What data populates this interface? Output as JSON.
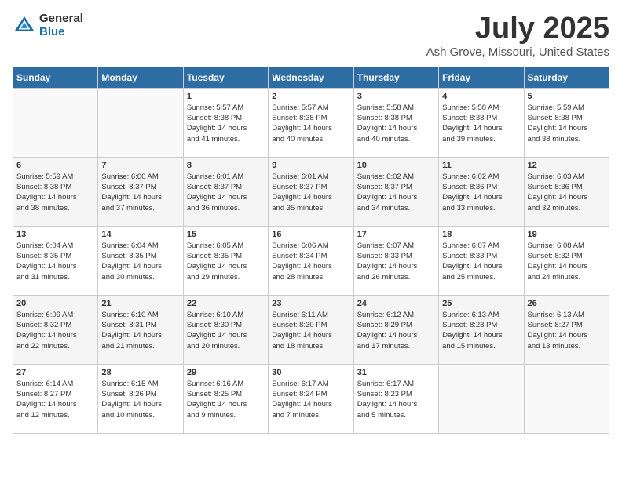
{
  "logo": {
    "general": "General",
    "blue": "Blue"
  },
  "title": "July 2025",
  "subtitle": "Ash Grove, Missouri, United States",
  "headers": [
    "Sunday",
    "Monday",
    "Tuesday",
    "Wednesday",
    "Thursday",
    "Friday",
    "Saturday"
  ],
  "weeks": [
    [
      {
        "day": "",
        "info": ""
      },
      {
        "day": "",
        "info": ""
      },
      {
        "day": "1",
        "info": "Sunrise: 5:57 AM\nSunset: 8:38 PM\nDaylight: 14 hours\nand 41 minutes."
      },
      {
        "day": "2",
        "info": "Sunrise: 5:57 AM\nSunset: 8:38 PM\nDaylight: 14 hours\nand 40 minutes."
      },
      {
        "day": "3",
        "info": "Sunrise: 5:58 AM\nSunset: 8:38 PM\nDaylight: 14 hours\nand 40 minutes."
      },
      {
        "day": "4",
        "info": "Sunrise: 5:58 AM\nSunset: 8:38 PM\nDaylight: 14 hours\nand 39 minutes."
      },
      {
        "day": "5",
        "info": "Sunrise: 5:59 AM\nSunset: 8:38 PM\nDaylight: 14 hours\nand 38 minutes."
      }
    ],
    [
      {
        "day": "6",
        "info": "Sunrise: 5:59 AM\nSunset: 8:38 PM\nDaylight: 14 hours\nand 38 minutes."
      },
      {
        "day": "7",
        "info": "Sunrise: 6:00 AM\nSunset: 8:37 PM\nDaylight: 14 hours\nand 37 minutes."
      },
      {
        "day": "8",
        "info": "Sunrise: 6:01 AM\nSunset: 8:37 PM\nDaylight: 14 hours\nand 36 minutes."
      },
      {
        "day": "9",
        "info": "Sunrise: 6:01 AM\nSunset: 8:37 PM\nDaylight: 14 hours\nand 35 minutes."
      },
      {
        "day": "10",
        "info": "Sunrise: 6:02 AM\nSunset: 8:37 PM\nDaylight: 14 hours\nand 34 minutes."
      },
      {
        "day": "11",
        "info": "Sunrise: 6:02 AM\nSunset: 8:36 PM\nDaylight: 14 hours\nand 33 minutes."
      },
      {
        "day": "12",
        "info": "Sunrise: 6:03 AM\nSunset: 8:36 PM\nDaylight: 14 hours\nand 32 minutes."
      }
    ],
    [
      {
        "day": "13",
        "info": "Sunrise: 6:04 AM\nSunset: 8:35 PM\nDaylight: 14 hours\nand 31 minutes."
      },
      {
        "day": "14",
        "info": "Sunrise: 6:04 AM\nSunset: 8:35 PM\nDaylight: 14 hours\nand 30 minutes."
      },
      {
        "day": "15",
        "info": "Sunrise: 6:05 AM\nSunset: 8:35 PM\nDaylight: 14 hours\nand 29 minutes."
      },
      {
        "day": "16",
        "info": "Sunrise: 6:06 AM\nSunset: 8:34 PM\nDaylight: 14 hours\nand 28 minutes."
      },
      {
        "day": "17",
        "info": "Sunrise: 6:07 AM\nSunset: 8:33 PM\nDaylight: 14 hours\nand 26 minutes."
      },
      {
        "day": "18",
        "info": "Sunrise: 6:07 AM\nSunset: 8:33 PM\nDaylight: 14 hours\nand 25 minutes."
      },
      {
        "day": "19",
        "info": "Sunrise: 6:08 AM\nSunset: 8:32 PM\nDaylight: 14 hours\nand 24 minutes."
      }
    ],
    [
      {
        "day": "20",
        "info": "Sunrise: 6:09 AM\nSunset: 8:32 PM\nDaylight: 14 hours\nand 22 minutes."
      },
      {
        "day": "21",
        "info": "Sunrise: 6:10 AM\nSunset: 8:31 PM\nDaylight: 14 hours\nand 21 minutes."
      },
      {
        "day": "22",
        "info": "Sunrise: 6:10 AM\nSunset: 8:30 PM\nDaylight: 14 hours\nand 20 minutes."
      },
      {
        "day": "23",
        "info": "Sunrise: 6:11 AM\nSunset: 8:30 PM\nDaylight: 14 hours\nand 18 minutes."
      },
      {
        "day": "24",
        "info": "Sunrise: 6:12 AM\nSunset: 8:29 PM\nDaylight: 14 hours\nand 17 minutes."
      },
      {
        "day": "25",
        "info": "Sunrise: 6:13 AM\nSunset: 8:28 PM\nDaylight: 14 hours\nand 15 minutes."
      },
      {
        "day": "26",
        "info": "Sunrise: 6:13 AM\nSunset: 8:27 PM\nDaylight: 14 hours\nand 13 minutes."
      }
    ],
    [
      {
        "day": "27",
        "info": "Sunrise: 6:14 AM\nSunset: 8:27 PM\nDaylight: 14 hours\nand 12 minutes."
      },
      {
        "day": "28",
        "info": "Sunrise: 6:15 AM\nSunset: 8:26 PM\nDaylight: 14 hours\nand 10 minutes."
      },
      {
        "day": "29",
        "info": "Sunrise: 6:16 AM\nSunset: 8:25 PM\nDaylight: 14 hours\nand 9 minutes."
      },
      {
        "day": "30",
        "info": "Sunrise: 6:17 AM\nSunset: 8:24 PM\nDaylight: 14 hours\nand 7 minutes."
      },
      {
        "day": "31",
        "info": "Sunrise: 6:17 AM\nSunset: 8:23 PM\nDaylight: 14 hours\nand 5 minutes."
      },
      {
        "day": "",
        "info": ""
      },
      {
        "day": "",
        "info": ""
      }
    ]
  ]
}
